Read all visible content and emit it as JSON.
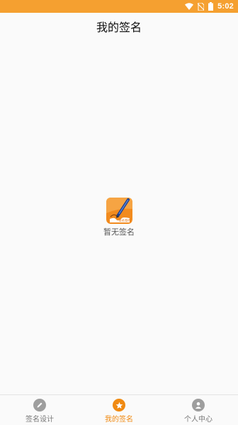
{
  "status_bar": {
    "time": "5:02",
    "background": "#f5a030",
    "icons": [
      "wifi-icon",
      "no-sim-icon",
      "battery-icon"
    ]
  },
  "header": {
    "title": "我的签名"
  },
  "empty_state": {
    "icon": "signature-app-logo",
    "logo_text": "签名签约",
    "message": "暂无签名"
  },
  "tabbar": {
    "active_color": "#f08a12",
    "inactive_color": "#9e9e9e",
    "tabs": [
      {
        "label": "签名设计",
        "icon": "pencil-icon",
        "active": false
      },
      {
        "label": "我的签名",
        "icon": "star-icon",
        "active": true
      },
      {
        "label": "个人中心",
        "icon": "person-icon",
        "active": false
      }
    ]
  }
}
